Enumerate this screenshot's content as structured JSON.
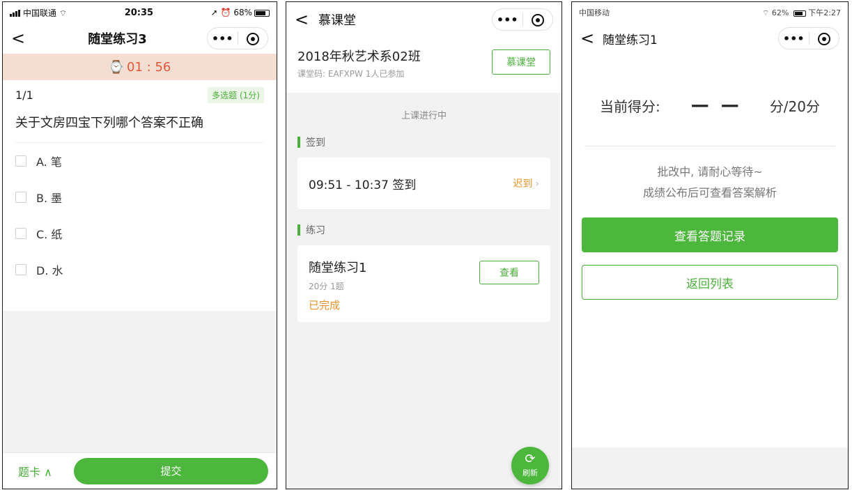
{
  "screen1": {
    "status": {
      "carrier": "中国联通",
      "time": "20:35",
      "battery": "68%"
    },
    "nav": {
      "back": "<",
      "title": "随堂练习3"
    },
    "timer": {
      "icon": "clock-icon",
      "value": "01 : 56"
    },
    "question": {
      "index": "1/1",
      "tag": "多选题 (1分)",
      "text": "关于文房四宝下列哪个答案不正确",
      "options": [
        "A. 笔",
        "B. 墨",
        "C. 纸",
        "D. 水"
      ]
    },
    "footer": {
      "card_label": "题卡 ∧",
      "submit_label": "提交"
    }
  },
  "screen2": {
    "nav": {
      "back": "<",
      "title": "慕课堂"
    },
    "class_info": {
      "name": "2018年秋艺术系02班",
      "meta": "课堂码: EAFXPW   1人已参加",
      "button": "慕课堂"
    },
    "status_text": "上课进行中",
    "sign_section": {
      "title": "签到",
      "time": "09:51 - 10:37 签到",
      "status": "迟到"
    },
    "practice_section": {
      "title": "练习",
      "name": "随堂练习1",
      "meta": "20分 1题",
      "state": "已完成",
      "button": "查看"
    },
    "fab": {
      "label": "刷新"
    }
  },
  "screen3": {
    "status": {
      "carrier": "中国移动",
      "battery": "62%",
      "time": "下午2:27"
    },
    "nav": {
      "back": "<",
      "title": "随堂练习1"
    },
    "score": {
      "label": "当前得分:",
      "value": "— —",
      "total": "分/20分"
    },
    "message": [
      "批改中, 请耐心等待~",
      "成绩公布后可查看答案解析"
    ],
    "primary_button": "查看答题记录",
    "secondary_button": "返回列表"
  },
  "colors": {
    "accent": "#4cb63d",
    "warning": "#e6922a",
    "timer": "#e2583a"
  }
}
